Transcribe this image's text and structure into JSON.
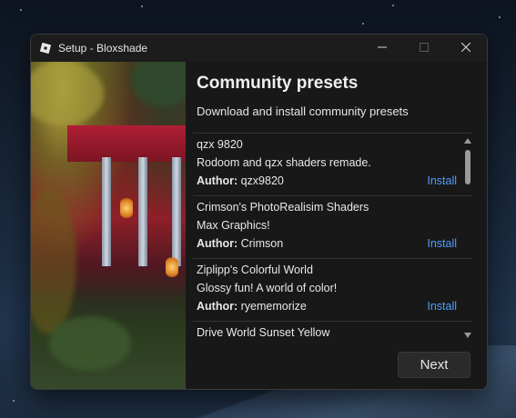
{
  "window": {
    "title": "Setup - Bloxshade",
    "controls": {
      "minimize_icon": "minimize-icon",
      "maximize_icon": "maximize-icon",
      "close_icon": "close-icon"
    }
  },
  "page": {
    "title": "Community presets",
    "subtitle": "Download and install community presets"
  },
  "author_label": "Author:",
  "presets": [
    {
      "name": "qzx 9820",
      "description": "Rodoom and qzx shaders remade.",
      "author": "qzx9820",
      "action": "Install"
    },
    {
      "name": "Crimson's PhotoRealisim Shaders",
      "description": "Max Graphics!",
      "author": "Crimson",
      "action": "Install"
    },
    {
      "name": "Ziplipp's Colorful World",
      "description": "Glossy fun! A world of color!",
      "author": "ryememorize",
      "action": "Install"
    },
    {
      "name": "Drive World Sunset Yellow",
      "description": "",
      "author": "",
      "action": ""
    }
  ],
  "footer": {
    "next_label": "Next"
  },
  "colors": {
    "accent_link": "#4f9eff",
    "background": "#181818"
  }
}
